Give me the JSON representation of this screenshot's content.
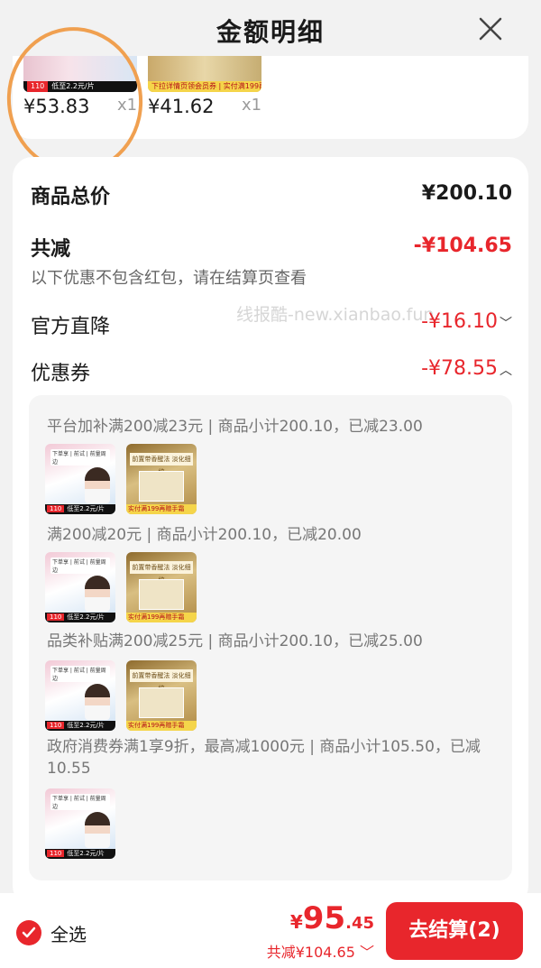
{
  "header": {
    "title": "金额明细"
  },
  "top_items": [
    {
      "price": "¥53.83",
      "qty": "x1",
      "badge": "110",
      "band_text": "低至2.2元/片"
    },
    {
      "price": "¥41.62",
      "qty": "x1",
      "band_text": "下拉详情页领会员券 | 实付满199再赠手霜"
    }
  ],
  "summary": {
    "goods_total_label": "商品总价",
    "goods_total_value": "¥200.10",
    "discount_label": "共减",
    "discount_value": "-¥104.65",
    "discount_note": "以下优惠不包含红包，请在结算页查看",
    "official_drop_label": "官方直降",
    "official_drop_value": "-¥16.10",
    "coupon_label": "优惠券",
    "coupon_value": "-¥78.55"
  },
  "watermark": "线报酷-new.xianbao.fun",
  "coupons": [
    {
      "text": "平台加补满200减23元 | 商品小计200.10，已减23.00"
    },
    {
      "text": "满200减20元 | 商品小计200.10，已减20.00"
    },
    {
      "text": "品类补贴满200减25元 | 商品小计200.10，已减25.00"
    },
    {
      "text": "政府消费券满1享9折，最高减1000元 | 商品小计105.50，已减10.55"
    }
  ],
  "product_images": {
    "a_head": "下单享 | 前试 | 前量周边",
    "a_badge": "110",
    "a_band": "低至2.2元/片",
    "b_ribbon": "前置带香醒法 淡化细纹",
    "b_band": "实付满199再赠手霜"
  },
  "bottom": {
    "select_all": "全选",
    "price_symbol": "¥",
    "price_int": "95",
    "price_dec": ".45",
    "total_discount": "共减¥104.65",
    "checkout": "去结算(2)"
  },
  "colors": {
    "accent": "#e8262c",
    "highlight": "#f0a050"
  }
}
